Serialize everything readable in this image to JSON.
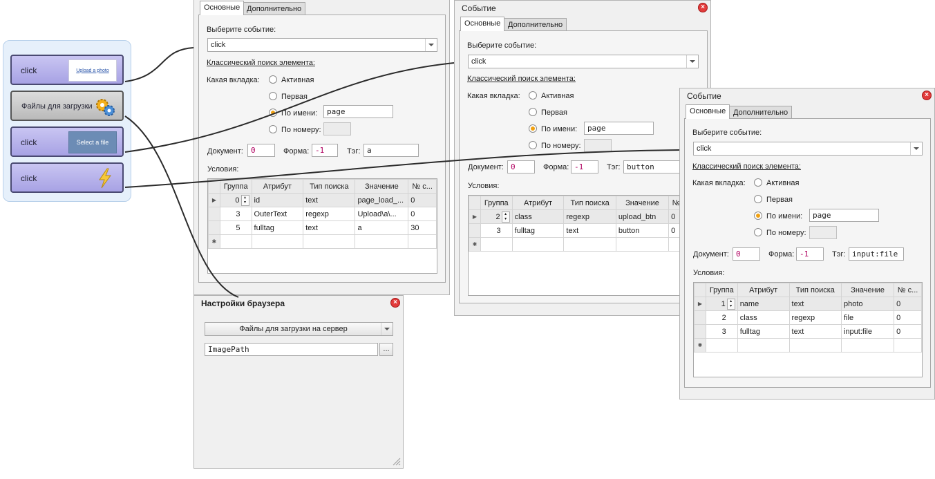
{
  "nodes": [
    {
      "label": "click",
      "thumb": "Upload a photo"
    },
    {
      "label": "Файлы для загрузки"
    },
    {
      "label": "click",
      "thumb": "Select a file"
    },
    {
      "label": "click"
    }
  ],
  "windows": [
    {
      "title": "",
      "tabs": [
        "Основные",
        "Дополнительно"
      ],
      "select_event_label": "Выберите событие:",
      "event_value": "click",
      "classic_search": "Классический поиск элемента:",
      "which_tab_label": "Какая вкладка:",
      "radios": [
        "Активная",
        "Первая",
        "По имени:",
        "По номеру:"
      ],
      "tab_name": "page",
      "document_label": "Документ:",
      "document": "0",
      "form_label": "Форма:",
      "form": "-1",
      "tag_label": "Тэг:",
      "tag": "a",
      "conditions_label": "Условия:",
      "columns": [
        "Группа",
        "Атрибут",
        "Тип поиска",
        "Значение",
        "№ с..."
      ],
      "rows": [
        {
          "group": "0",
          "attr": "id",
          "type": "text",
          "value": "page_load_...",
          "num": "0"
        },
        {
          "group": "3",
          "attr": "OuterText",
          "type": "regexp",
          "value": "Upload\\a\\...",
          "num": "0"
        },
        {
          "group": "5",
          "attr": "fulltag",
          "type": "text",
          "value": "a",
          "num": "30"
        }
      ]
    },
    {
      "title": "Событие",
      "tabs": [
        "Основные",
        "Дополнительно"
      ],
      "select_event_label": "Выберите событие:",
      "event_value": "click",
      "classic_search": "Классический поиск элемента:",
      "which_tab_label": "Какая вкладка:",
      "radios": [
        "Активная",
        "Первая",
        "По имени:",
        "По номеру:"
      ],
      "tab_name": "page",
      "document_label": "Документ:",
      "document": "0",
      "form_label": "Форма:",
      "form": "-1",
      "tag_label": "Тэг:",
      "tag": "button",
      "conditions_label": "Условия:",
      "columns": [
        "Группа",
        "Атрибут",
        "Тип поиска",
        "Значение",
        "№"
      ],
      "rows": [
        {
          "group": "2",
          "attr": "class",
          "type": "regexp",
          "value": "upload_btn",
          "num": "0"
        },
        {
          "group": "3",
          "attr": "fulltag",
          "type": "text",
          "value": "button",
          "num": "0"
        }
      ]
    },
    {
      "title": "Событие",
      "tabs": [
        "Основные",
        "Дополнительно"
      ],
      "select_event_label": "Выберите событие:",
      "event_value": "click",
      "classic_search": "Классический поиск элемента:",
      "which_tab_label": "Какая вкладка:",
      "radios": [
        "Активная",
        "Первая",
        "По имени:",
        "По номеру:"
      ],
      "tab_name": "page",
      "document_label": "Документ:",
      "document": "0",
      "form_label": "Форма:",
      "form": "-1",
      "tag_label": "Тэг:",
      "tag": "input:file",
      "conditions_label": "Условия:",
      "columns": [
        "Группа",
        "Атрибут",
        "Тип поиска",
        "Значение",
        "№ с..."
      ],
      "rows": [
        {
          "group": "1",
          "attr": "name",
          "type": "text",
          "value": "photo",
          "num": "0"
        },
        {
          "group": "2",
          "attr": "class",
          "type": "regexp",
          "value": "file",
          "num": "0"
        },
        {
          "group": "3",
          "attr": "fulltag",
          "type": "text",
          "value": "input:file",
          "num": "0"
        }
      ]
    }
  ],
  "browser_settings": {
    "title": "Настройки браузера",
    "dropdown": "Файлы для загрузки на сервер",
    "path": "ImagePath",
    "browse_label": "..."
  },
  "colors": {
    "accent": "#f0a010",
    "close": "#e23b3b",
    "node_purple": "#b8b4ec"
  },
  "icons": [
    "gear-icon",
    "lightning-icon",
    "close-icon",
    "chevron-down-icon",
    "resize-grip-icon"
  ]
}
